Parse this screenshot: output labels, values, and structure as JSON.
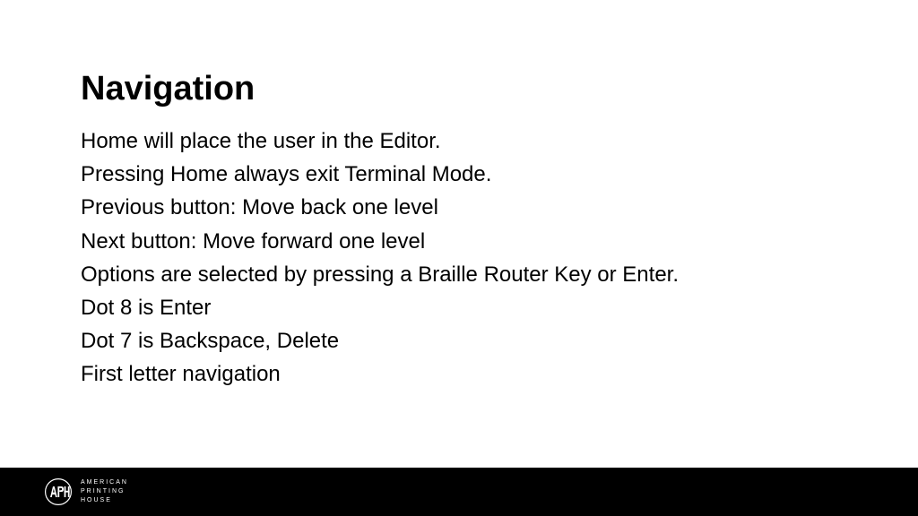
{
  "slide": {
    "title": "Navigation",
    "lines": [
      "Home will place the user in the Editor.",
      "Pressing Home always exit Terminal Mode.",
      "Previous button: Move back one level",
      "Next button: Move forward one level",
      "Options are selected by pressing a Braille Router Key or Enter.",
      "Dot 8 is Enter",
      "Dot 7 is Backspace, Delete",
      "First letter navigation"
    ]
  },
  "footer": {
    "org_line1": "AMERICAN",
    "org_line2": "PRINTING",
    "org_line3": "HOUSE"
  }
}
